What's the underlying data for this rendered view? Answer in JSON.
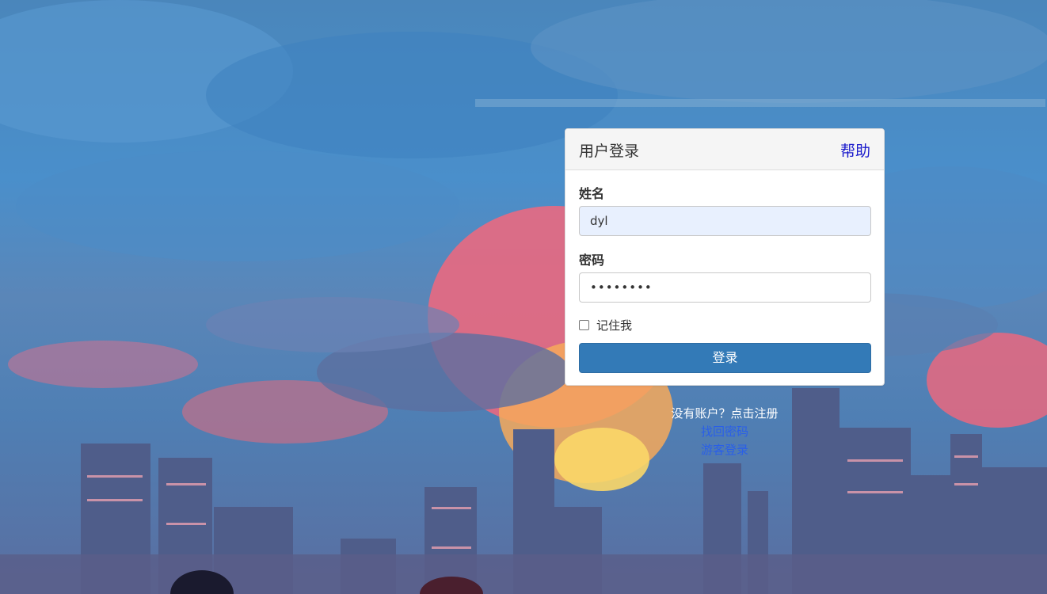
{
  "panel": {
    "title": "用户登录",
    "help_label": "帮助"
  },
  "form": {
    "username_label": "姓名",
    "username_value": "dyl",
    "password_label": "密码",
    "password_value": "dylpass1",
    "remember_label": "记住我",
    "remember_checked": false,
    "login_label": "登录"
  },
  "links": {
    "register_text": "没有账户？点击注册",
    "recover_password": "找回密码",
    "guest_login": "游客登录"
  },
  "colors": {
    "primary_button": "#337ab7",
    "link": "#2a5fe8",
    "help_link": "#1a1acc",
    "autofill_background": "#e8f0fe"
  }
}
